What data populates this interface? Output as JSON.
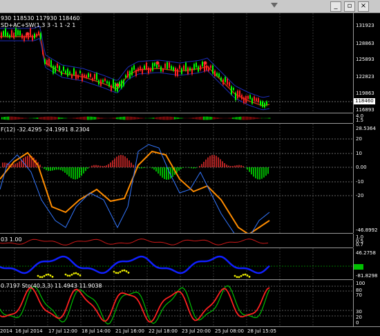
{
  "window": {
    "minimize": "_",
    "restore": "▫",
    "close": "×"
  },
  "main": {
    "ohlc_text": "930 118530 117930 118460",
    "indicator_text": "SD+AC+SW(1,3 3 -1 1 -2 1",
    "price_labels": [
      "131923",
      "128863",
      "125893",
      "122823",
      "119863",
      "116893"
    ],
    "current_price": "118460"
  },
  "mini": {
    "labels": [
      "4.0",
      "1.5"
    ]
  },
  "osc": {
    "title": "F(12) -32.4295 -24.1991 8.2304",
    "labels": [
      "28.5364",
      "20",
      "10",
      "0.00",
      "-10",
      "-20",
      "-46.8992"
    ]
  },
  "atr": {
    "title": "03 1.00",
    "labels": [
      "1.0",
      "0.5",
      "0.7"
    ]
  },
  "cci": {
    "labels": [
      "46.2758",
      "-81.8298"
    ],
    "highlight": ""
  },
  "stoch": {
    "title": "0.7197 Sto(40,3,3) 11.4943 11.9038",
    "labels": [
      "100",
      "80",
      "70",
      "30",
      "20",
      "0"
    ]
  },
  "xaxis": [
    "2014",
    "16 Jul 2014",
    "17 Jul 12:00",
    "18 Jul 14:00",
    "21 Jul 16:00",
    "22 Jul 18:00",
    "23 Jul 20:00",
    "25 Jul 08:00",
    "28 Jul 15:05"
  ],
  "colors": {
    "up": "#00ff00",
    "down": "#ff2020",
    "ema": "#ff8c00",
    "signal": "#3377ff"
  }
}
